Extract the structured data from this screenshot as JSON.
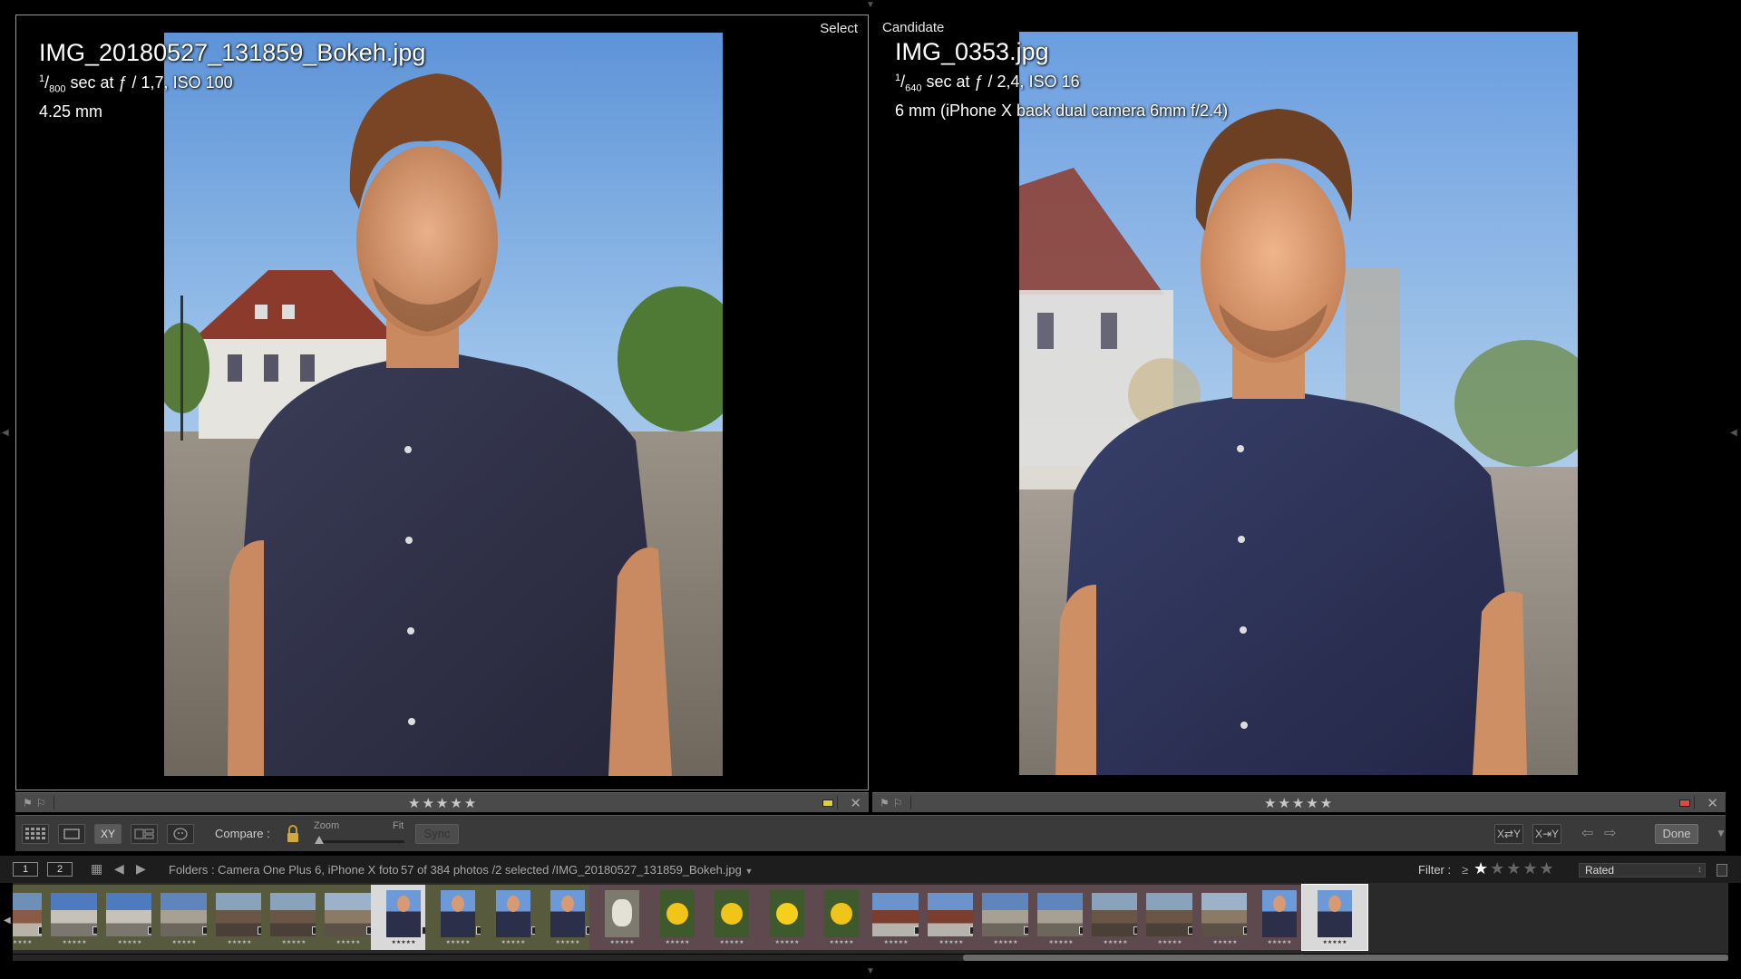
{
  "select_pane": {
    "label": "Select",
    "filename": "IMG_20180527_131859_Bokeh.jpg",
    "exposure_num": "1",
    "exposure_den": "800",
    "exposure_rest": " sec at ƒ / 1,7, ISO 100",
    "focal": "4.25 mm",
    "stars": "★★★★★",
    "color_label": "#e0d13a"
  },
  "candidate_pane": {
    "label": "Candidate",
    "filename": "IMG_0353.jpg",
    "exposure_num": "1",
    "exposure_den": "640",
    "exposure_rest": " sec at ƒ / 2,4, ISO 16",
    "focal": "6 mm (iPhone X back dual camera 6mm f/2.4)",
    "stars": "★★★★★",
    "color_label": "#d94a4a"
  },
  "toolbar": {
    "compare_label": "Compare :",
    "zoom_label": "Zoom",
    "fit_label": "Fit",
    "sync_label": "Sync",
    "swap_label": "X⇄Y",
    "make_select_label": "X⇥Y",
    "done_label": "Done",
    "xy_label": "XY"
  },
  "filmstrip_header": {
    "screen_1": "1",
    "screen_2": "2",
    "source": "Folders : Camera One Plus 6, iPhone X foto",
    "count": "57 of 384 photos /2 selected /",
    "selected_file": "IMG_20180527_131859_Bokeh.jpg",
    "filter_label": "Filter :",
    "filter_ge": "≥",
    "filter_stars_on": "★",
    "filter_stars_off": "★★★★",
    "filter_value": "Rated"
  },
  "thumbnails": [
    {
      "kind": "building",
      "label": "pick"
    },
    {
      "kind": "sky-street",
      "label": "pick"
    },
    {
      "kind": "sky-street",
      "label": "pick"
    },
    {
      "kind": "street",
      "label": "pick"
    },
    {
      "kind": "ruin",
      "label": "pick"
    },
    {
      "kind": "ruin",
      "label": "pick"
    },
    {
      "kind": "fountain",
      "label": "pick"
    },
    {
      "kind": "portrait",
      "label": "selected"
    },
    {
      "kind": "portrait",
      "label": "pick"
    },
    {
      "kind": "portrait",
      "label": "pick"
    },
    {
      "kind": "portrait",
      "label": "pick"
    },
    {
      "kind": "dog",
      "label": "red"
    },
    {
      "kind": "flower",
      "label": "red"
    },
    {
      "kind": "flower",
      "label": "red"
    },
    {
      "kind": "flower-big",
      "label": "red"
    },
    {
      "kind": "flower",
      "label": "red"
    },
    {
      "kind": "church",
      "label": "red"
    },
    {
      "kind": "church",
      "label": "red"
    },
    {
      "kind": "street",
      "label": "red"
    },
    {
      "kind": "street",
      "label": "red"
    },
    {
      "kind": "ruin",
      "label": "red"
    },
    {
      "kind": "ruin",
      "label": "red"
    },
    {
      "kind": "fountain",
      "label": "red"
    },
    {
      "kind": "portrait",
      "label": "red"
    },
    {
      "kind": "portrait",
      "label": "candidate"
    }
  ],
  "thumb_stars": "★★★★★"
}
